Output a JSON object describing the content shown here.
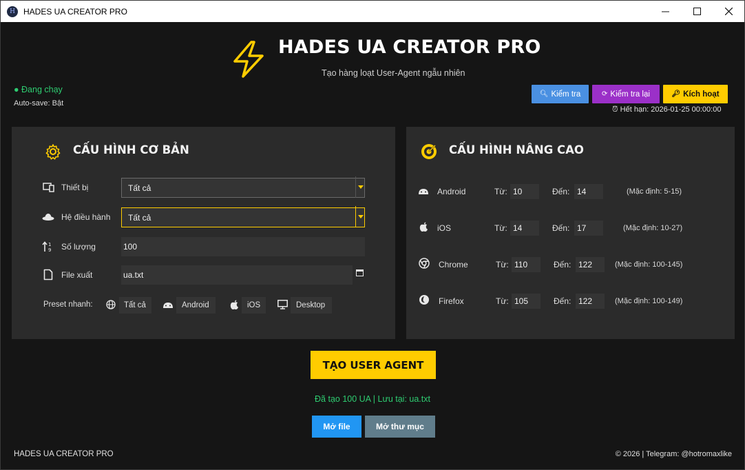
{
  "window": {
    "title": "HADES UA CREATOR PRO",
    "controls": {
      "minimize": "—",
      "maximize": "☐",
      "close": "✕"
    }
  },
  "header": {
    "title": "HADES UA CREATOR PRO",
    "subtitle": "Tạo hàng loạt User-Agent ngẫu nhiên",
    "accent": "#ffcc00"
  },
  "status": {
    "running": "● Đang chạy",
    "autosave": "Auto-save: Bật",
    "color": "#2ecc71"
  },
  "actions": {
    "check": {
      "label": "Kiểm tra",
      "color": "#4a90e2"
    },
    "recheck": {
      "label": "Kiểm tra lại",
      "color": "#9b30c8"
    },
    "activate": {
      "label": "Kích hoạt",
      "color": "#ffcc00"
    },
    "expiry": "Hết hạn: 2026-01-25 00:00:00"
  },
  "basic": {
    "title": "CẤU HÌNH CƠ BẢN",
    "device": {
      "label": "Thiết bị",
      "value": "Tất cả"
    },
    "os": {
      "label": "Hệ điều hành",
      "value": "Tất cả"
    },
    "quantity": {
      "label": "Số lượng",
      "value": "100"
    },
    "file": {
      "label": "File xuất",
      "value": "ua.txt"
    },
    "preset": {
      "label": "Preset nhanh:",
      "items": [
        "Tất cả",
        "Android",
        "iOS",
        "Desktop"
      ]
    }
  },
  "advanced": {
    "title": "CẤU HÌNH NÂNG CAO",
    "from_label": "Từ:",
    "to_label": "Đến:",
    "rows": [
      {
        "name": "Android",
        "from": "10",
        "to": "14",
        "default": "(Mặc định: 5-15)"
      },
      {
        "name": "iOS",
        "from": "14",
        "to": "17",
        "default": "(Mặc định: 10-27)"
      },
      {
        "name": "Chrome",
        "from": "110",
        "to": "122",
        "default": "(Mặc định: 100-145)"
      },
      {
        "name": "Firefox",
        "from": "105",
        "to": "122",
        "default": "(Mặc định: 100-149)"
      }
    ]
  },
  "generate": {
    "button": "TẠO USER AGENT",
    "result": "Đã tạo 100 UA | Lưu tại: ua.txt",
    "open_file": "Mở file",
    "open_folder": "Mở thư mục"
  },
  "footer": {
    "left": "HADES UA CREATOR PRO",
    "right": "© 2026 | Telegram: @hotromaxlike"
  }
}
